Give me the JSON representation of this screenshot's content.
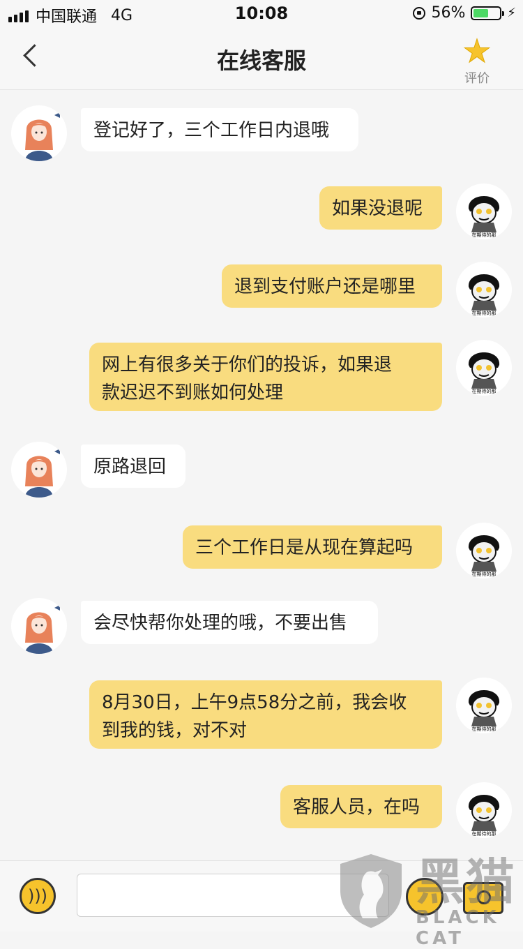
{
  "status_bar": {
    "carrier": "中国联通",
    "network": "4G",
    "time": "10:08",
    "battery_percent": "56%",
    "battery_level": 0.56
  },
  "nav": {
    "title": "在线客服",
    "rate_label": "评价",
    "accent_color": "#f6c32c"
  },
  "messages": [
    {
      "sender": "agent",
      "text": "登记好了，三个工作日内退哦"
    },
    {
      "sender": "user",
      "text": "如果没退呢"
    },
    {
      "sender": "user",
      "text": "退到支付账户还是哪里"
    },
    {
      "sender": "user",
      "lines": [
        "网上有很多关于你们的投诉，如果退",
        "款迟迟不到账如何处理"
      ]
    },
    {
      "sender": "agent",
      "text": "原路退回"
    },
    {
      "sender": "user",
      "text": "三个工作日是从现在算起吗"
    },
    {
      "sender": "agent",
      "text": "会尽快帮你处理的哦，不要出售"
    },
    {
      "sender": "user",
      "lines": [
        "8月30日，上午9点58分之前，我会收",
        "到我的钱，对不对"
      ]
    },
    {
      "sender": "user",
      "text": "客服人员，在吗"
    }
  ],
  "user_avatar_caption": "在期待的那",
  "watermark": {
    "main": "黑猫",
    "sub": "BLACK CAT"
  },
  "colors": {
    "user_bubble": "#f9dc7f",
    "agent_bubble": "#ffffff",
    "background": "#f5f5f5"
  }
}
